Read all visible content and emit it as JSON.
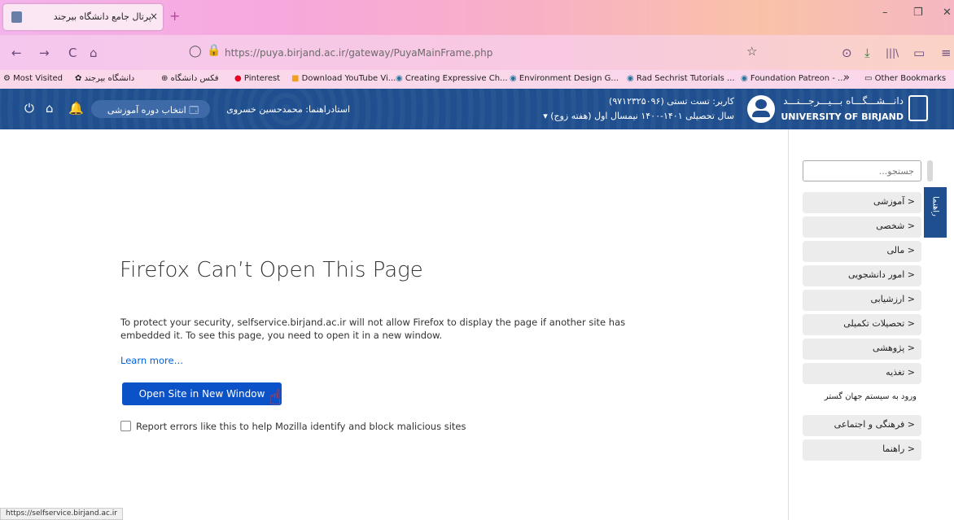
{
  "tab": {
    "title": "پرتال جامع دانشگاه بیرجند",
    "close": "×",
    "new_tab": "+"
  },
  "window": {
    "minimize": "–",
    "restore": "❐",
    "close": "✕"
  },
  "nav": {
    "back": "←",
    "forward": "→",
    "reload": "C",
    "home": "⌂",
    "url": "https://puya.birjand.ac.ir/gateway/PuyaMainFrame.php",
    "shield": "◯",
    "lock": "🔒",
    "star": "☆",
    "pocket": "⊙",
    "download": "⤓",
    "library": "|||\\",
    "sidebar": "▭",
    "menu": "≡"
  },
  "bookmarks": [
    "Most Visited",
    "دانشگاه بیرجند",
    "فکس دانشگاه",
    "Pinterest",
    "Download YouTube Vi...",
    "Creating Expressive Ch...",
    "Environment Design G...",
    "Rad Sechrist Tutorials ...",
    "Foundation Patreon - ...",
    "Other Bookmarks"
  ],
  "bookmarks_overflow": "»",
  "header": {
    "logo_line1": "دانـــشـــگـــاه بـــیـــرجـــنـــد",
    "logo_line2": "UNIVERSITY OF BIRJAND",
    "user_line1": "کاربر: تست تستی (۹۷۱۲۳۲۵۰۹۶)",
    "user_line2": "سال تحصیلی ۱۴۰۱-۱۴۰۰ نیمسال اول (هفته زوج) ▾",
    "advisor": "استادراهنما: محمدحسین خسروی",
    "select_course": "انتخاب دوره آموزشی",
    "power": "⏻",
    "home": "⌂",
    "bell": "🔔"
  },
  "sidebar": {
    "search_placeholder": "جستجو...",
    "help_tab": "راهنما",
    "items": [
      "آموزشی",
      "شخصی",
      "مالی",
      "امور دانشجویی",
      "ارزشیابی",
      "تحصیلات تکمیلی",
      "پژوهشی",
      "تغذیه"
    ],
    "plain_item": "ورود به سیستم جهان گستر",
    "items_bottom": [
      "فرهنگی و اجتماعی",
      "راهنما"
    ],
    "chevron": "<"
  },
  "error_page": {
    "title": "Firefox Can’t Open This Page",
    "body": "To protect your security, selfservice.birjand.ac.ir will not allow Firefox to display the page if another site has embedded it. To see this page, you need to open it in a new window.",
    "learn_more": "Learn more…",
    "open_button": "Open Site in New Window",
    "report_label": "Report errors like this to help Mozilla identify and block malicious sites"
  },
  "status_bar": "https://selfservice.birjand.ac.ir",
  "colors": {
    "header_bg": "#1f4f8f",
    "button_blue": "#0b52c9",
    "link_blue": "#0060df"
  }
}
